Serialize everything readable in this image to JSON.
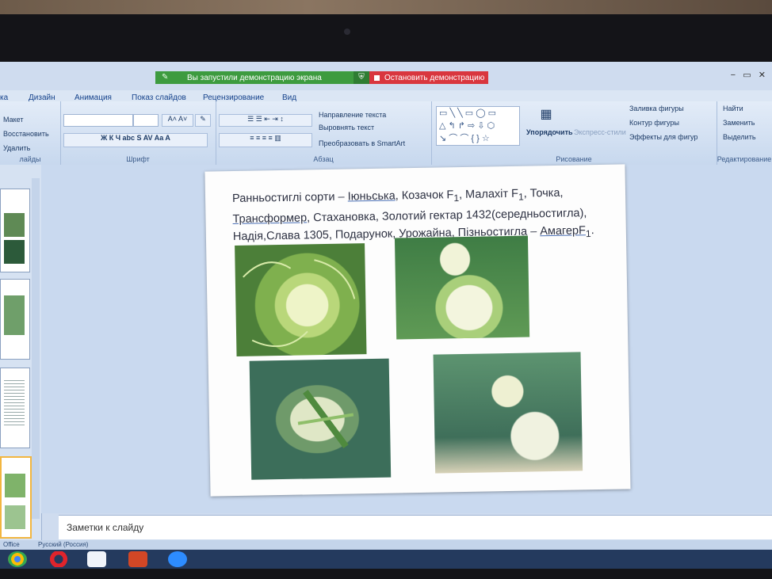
{
  "share_bar": {
    "message": "Вы запустили демонстрацию экрана",
    "stop_label": "Остановить демонстрацию"
  },
  "ribbon_tabs": [
    "ка",
    "Дизайн",
    "Анимация",
    "Показ слайдов",
    "Рецензирование",
    "Вид"
  ],
  "ribbon": {
    "slides_group": {
      "maket": "Макет",
      "restore": "Восстановить",
      "delete": "Удалить",
      "label": "лайды"
    },
    "font_group": {
      "label": "Шрифт"
    },
    "paragraph_group": {
      "text_direction": "Направление текста",
      "align_text": "Выровнять текст",
      "convert_smartart": "Преобразовать в SmartArt",
      "label": "Абзац"
    },
    "drawing_group": {
      "arrange": "Упорядочить",
      "quick_styles": "Экспресс-стили",
      "shape_fill": "Заливка фигуры",
      "shape_outline": "Контур фигуры",
      "shape_effects": "Эффекты для фигур",
      "label": "Рисование"
    },
    "editing_group": {
      "find": "Найти",
      "replace": "Заменить",
      "select": "Выделить",
      "label": "Редактирование"
    }
  },
  "slide": {
    "line1_a": "Ранньостиглі сорти – ",
    "line1_link": "Іюньська",
    "line1_b": ", Козачок F",
    "line1_sub1": "1",
    "line1_c": ", Малахіт F",
    "line1_sub2": "1",
    "line1_d": ", Точка,",
    "line2_link": "Трансформер",
    "line2_b": ", Стахановка, Золотий гектар 1432(середньостигла),",
    "line3_a": "Надія,Слава 1305, Подарунок, Урожайна, Пізньостигла – ",
    "line3_link": "АмагерF",
    "line3_sub": "1",
    "line3_end": "."
  },
  "notes_placeholder": "Заметки к слайду",
  "status": {
    "office": "Office",
    "lang": "Русский (Россия)"
  },
  "colors": {
    "share_green": "#3d9b3f",
    "share_red": "#d9363e",
    "ribbon_bg": "#dbe6f4"
  }
}
